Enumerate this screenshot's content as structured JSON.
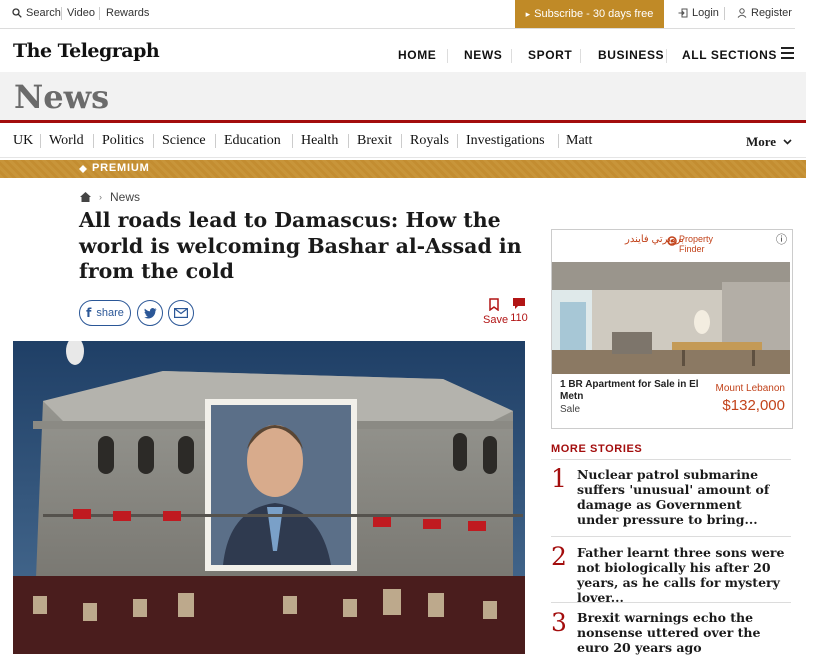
{
  "utility": {
    "search": "Search",
    "video": "Video",
    "rewards": "Rewards",
    "subscribe": "Subscribe - 30 days free",
    "login": "Login",
    "register": "Register"
  },
  "masthead": {
    "logo": "The Telegraph",
    "nav": [
      "HOME",
      "NEWS",
      "SPORT",
      "BUSINESS",
      "ALL SECTIONS"
    ]
  },
  "section": {
    "title": "News"
  },
  "subnav": {
    "items": [
      "UK",
      "World",
      "Politics",
      "Science",
      "Education",
      "Health",
      "Brexit",
      "Royals",
      "Investigations",
      "Matt"
    ],
    "more": "More"
  },
  "premium": {
    "label": "PREMIUM"
  },
  "article": {
    "breadcrumb": "News",
    "headline": "All roads lead to Damascus: How the world is welcoming Bashar al-Assad in from the cold",
    "share_label": "share",
    "save_label": "Save",
    "comment_count": "110"
  },
  "ad": {
    "brand_en": "Property Finder",
    "brand_ar": "بروبرتي فايندر",
    "listing_title": "1 BR Apartment for Sale in El Metn",
    "listing_type": "Sale",
    "location": "Mount Lebanon",
    "price": "$132,000",
    "info_icon": "ⓘ"
  },
  "more_stories": {
    "heading": "MORE STORIES",
    "items": [
      {
        "num": "1",
        "text": "Nuclear patrol submarine suffers 'unusual' amount of damage as Government under pressure to bring..."
      },
      {
        "num": "2",
        "text": "Father learnt three sons were not biologically his after 20 years, as he calls for mystery lover..."
      },
      {
        "num": "3",
        "text": "Brexit warnings echo the nonsense uttered over the euro 20 years ago"
      }
    ]
  },
  "colors": {
    "accent_red": "#a30d0d",
    "premium_gold": "#c08a27",
    "share_blue": "#2b5797"
  }
}
